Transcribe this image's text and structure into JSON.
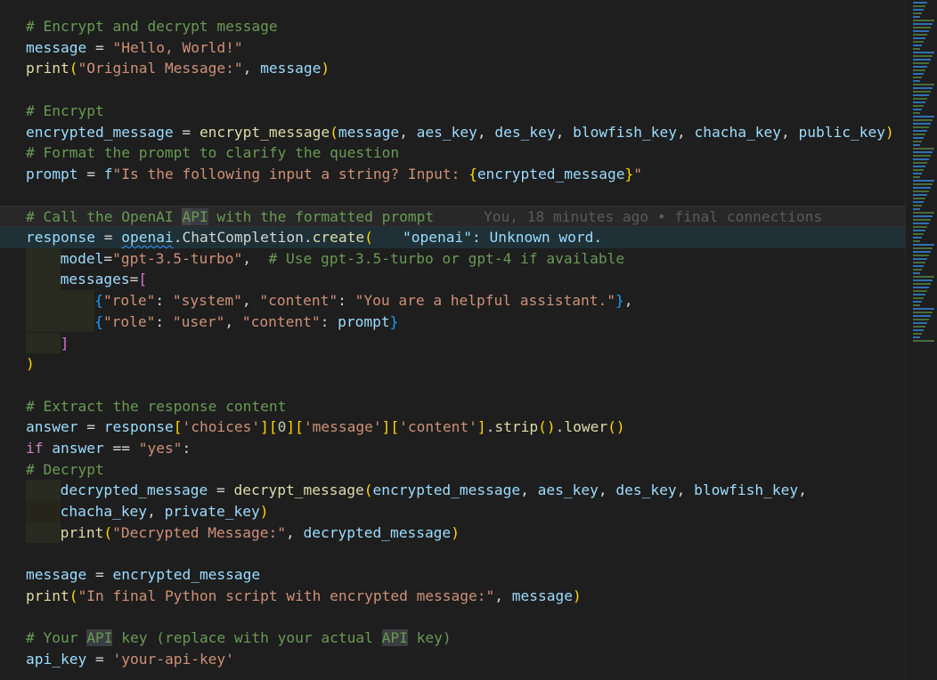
{
  "editor": {
    "lines": [
      [
        {
          "t": "# Encrypt and decrypt message",
          "c": "comment"
        }
      ],
      [
        {
          "t": "message",
          "c": "var"
        },
        {
          "t": " = ",
          "c": "op"
        },
        {
          "t": "\"Hello, World!\"",
          "c": "str"
        }
      ],
      [
        {
          "t": "print",
          "c": "fn"
        },
        {
          "t": "(",
          "c": "brace1"
        },
        {
          "t": "\"Original Message:\"",
          "c": "str"
        },
        {
          "t": ", ",
          "c": "op"
        },
        {
          "t": "message",
          "c": "var"
        },
        {
          "t": ")",
          "c": "brace1"
        }
      ],
      [],
      [
        {
          "t": "# Encrypt",
          "c": "comment"
        }
      ],
      [
        {
          "t": "encrypted_message",
          "c": "var"
        },
        {
          "t": " = ",
          "c": "op"
        },
        {
          "t": "encrypt_message",
          "c": "fn"
        },
        {
          "t": "(",
          "c": "brace1"
        },
        {
          "t": "message",
          "c": "var"
        },
        {
          "t": ", ",
          "c": "op"
        },
        {
          "t": "aes_key",
          "c": "var"
        },
        {
          "t": ", ",
          "c": "op"
        },
        {
          "t": "des_key",
          "c": "var"
        },
        {
          "t": ", ",
          "c": "op"
        },
        {
          "t": "blowfish_key",
          "c": "var"
        },
        {
          "t": ", ",
          "c": "op"
        },
        {
          "t": "chacha_key",
          "c": "var"
        },
        {
          "t": ", ",
          "c": "op"
        },
        {
          "t": "public_key",
          "c": "var"
        },
        {
          "t": ")",
          "c": "brace1"
        }
      ],
      [
        {
          "t": "# Format the prompt to clarify the question",
          "c": "comment"
        }
      ],
      [
        {
          "t": "prompt",
          "c": "var"
        },
        {
          "t": " = ",
          "c": "op"
        },
        {
          "t": "f",
          "c": "kw2"
        },
        {
          "t": "\"Is the following input a string? Input: ",
          "c": "str"
        },
        {
          "t": "{",
          "c": "brace1"
        },
        {
          "t": "encrypted_message",
          "c": "var"
        },
        {
          "t": "}",
          "c": "brace1"
        },
        {
          "t": "\"",
          "c": "str"
        }
      ],
      [],
      [
        {
          "t": "# Call the OpenAI ",
          "c": "comment"
        },
        {
          "t": "A",
          "c": "comment-cursor"
        },
        {
          "t": "PI",
          "c": "comment-hl"
        },
        {
          "t": " with the formatted prompt",
          "c": "comment"
        }
      ],
      [
        {
          "t": "response",
          "c": "var"
        },
        {
          "t": " = ",
          "c": "op"
        },
        {
          "t": "openai",
          "c": "var-squiggle"
        },
        {
          "t": ".",
          "c": "op"
        },
        {
          "t": "ChatCompletion",
          "c": "op"
        },
        {
          "t": ".",
          "c": "op"
        },
        {
          "t": "create",
          "c": "fn"
        },
        {
          "t": "(",
          "c": "brace1"
        }
      ],
      [
        {
          "indent": 1
        },
        {
          "t": "model",
          "c": "var"
        },
        {
          "t": "=",
          "c": "op"
        },
        {
          "t": "\"gpt-3.5-turbo\"",
          "c": "str"
        },
        {
          "t": ",  ",
          "c": "op"
        },
        {
          "t": "# Use gpt-3.5-turbo or gpt-4 if available",
          "c": "comment"
        }
      ],
      [
        {
          "indent": 1
        },
        {
          "t": "messages",
          "c": "var"
        },
        {
          "t": "=",
          "c": "op"
        },
        {
          "t": "[",
          "c": "brace2"
        }
      ],
      [
        {
          "indent": 2
        },
        {
          "t": "{",
          "c": "brace3"
        },
        {
          "t": "\"role\"",
          "c": "str"
        },
        {
          "t": ": ",
          "c": "op"
        },
        {
          "t": "\"system\"",
          "c": "str"
        },
        {
          "t": ", ",
          "c": "op"
        },
        {
          "t": "\"content\"",
          "c": "str"
        },
        {
          "t": ": ",
          "c": "op"
        },
        {
          "t": "\"You are a helpful assistant.\"",
          "c": "str"
        },
        {
          "t": "}",
          "c": "brace3"
        },
        {
          "t": ",",
          "c": "op"
        }
      ],
      [
        {
          "indent": 2
        },
        {
          "t": "{",
          "c": "brace3"
        },
        {
          "t": "\"role\"",
          "c": "str"
        },
        {
          "t": ": ",
          "c": "op"
        },
        {
          "t": "\"user\"",
          "c": "str"
        },
        {
          "t": ", ",
          "c": "op"
        },
        {
          "t": "\"content\"",
          "c": "str"
        },
        {
          "t": ": ",
          "c": "op"
        },
        {
          "t": "prompt",
          "c": "var"
        },
        {
          "t": "}",
          "c": "brace3"
        }
      ],
      [
        {
          "indent": 1
        },
        {
          "t": "]",
          "c": "brace2"
        }
      ],
      [
        {
          "t": ")",
          "c": "brace1"
        }
      ],
      [],
      [
        {
          "t": "# Extract the response content",
          "c": "comment"
        }
      ],
      [
        {
          "t": "answer",
          "c": "var"
        },
        {
          "t": " = ",
          "c": "op"
        },
        {
          "t": "response",
          "c": "var"
        },
        {
          "t": "[",
          "c": "brace1"
        },
        {
          "t": "'choices'",
          "c": "str"
        },
        {
          "t": "]",
          "c": "brace1"
        },
        {
          "t": "[",
          "c": "brace1"
        },
        {
          "t": "0",
          "c": "num"
        },
        {
          "t": "]",
          "c": "brace1"
        },
        {
          "t": "[",
          "c": "brace1"
        },
        {
          "t": "'message'",
          "c": "str"
        },
        {
          "t": "]",
          "c": "brace1"
        },
        {
          "t": "[",
          "c": "brace1"
        },
        {
          "t": "'content'",
          "c": "str"
        },
        {
          "t": "]",
          "c": "brace1"
        },
        {
          "t": ".",
          "c": "op"
        },
        {
          "t": "strip",
          "c": "fn"
        },
        {
          "t": "()",
          "c": "brace1"
        },
        {
          "t": ".",
          "c": "op"
        },
        {
          "t": "lower",
          "c": "fn"
        },
        {
          "t": "()",
          "c": "brace1"
        }
      ],
      [
        {
          "t": "if",
          "c": "kw"
        },
        {
          "t": " ",
          "c": "op"
        },
        {
          "t": "answer",
          "c": "var"
        },
        {
          "t": " == ",
          "c": "op"
        },
        {
          "t": "\"yes\"",
          "c": "str"
        },
        {
          "t": ":",
          "c": "op"
        }
      ],
      [
        {
          "t": "# Decrypt",
          "c": "comment"
        }
      ],
      [
        {
          "indent": 1
        },
        {
          "t": "decrypted_message",
          "c": "var"
        },
        {
          "t": " = ",
          "c": "op"
        },
        {
          "t": "decrypt_message",
          "c": "fn"
        },
        {
          "t": "(",
          "c": "brace1"
        },
        {
          "t": "encrypted_message",
          "c": "var"
        },
        {
          "t": ", ",
          "c": "op"
        },
        {
          "t": "aes_key",
          "c": "var"
        },
        {
          "t": ", ",
          "c": "op"
        },
        {
          "t": "des_key",
          "c": "var"
        },
        {
          "t": ", ",
          "c": "op"
        },
        {
          "t": "blowfish_key",
          "c": "var"
        },
        {
          "t": ",",
          "c": "op"
        }
      ],
      [
        {
          "indent": 1,
          "dim": true
        },
        {
          "t": "chacha_key",
          "c": "var"
        },
        {
          "t": ", ",
          "c": "op"
        },
        {
          "t": "private_key",
          "c": "var"
        },
        {
          "t": ")",
          "c": "brace1"
        }
      ],
      [
        {
          "indent": 1
        },
        {
          "t": "print",
          "c": "fn"
        },
        {
          "t": "(",
          "c": "brace1"
        },
        {
          "t": "\"Decrypted Message:\"",
          "c": "str"
        },
        {
          "t": ", ",
          "c": "op"
        },
        {
          "t": "decrypted_message",
          "c": "var"
        },
        {
          "t": ")",
          "c": "brace1"
        }
      ],
      [],
      [
        {
          "t": "message",
          "c": "var"
        },
        {
          "t": " = ",
          "c": "op"
        },
        {
          "t": "encrypted_message",
          "c": "var"
        }
      ],
      [
        {
          "t": "print",
          "c": "fn"
        },
        {
          "t": "(",
          "c": "brace1"
        },
        {
          "t": "\"In final Python script with encrypted message:\"",
          "c": "str"
        },
        {
          "t": ", ",
          "c": "op"
        },
        {
          "t": "message",
          "c": "var"
        },
        {
          "t": ")",
          "c": "brace1"
        }
      ],
      [],
      [
        {
          "t": "# Your ",
          "c": "comment"
        },
        {
          "t": "API",
          "c": "comment-hl"
        },
        {
          "t": " key (replace with your actual ",
          "c": "comment"
        },
        {
          "t": "API",
          "c": "comment-hl"
        },
        {
          "t": " key)",
          "c": "comment"
        }
      ],
      [
        {
          "t": "api_key",
          "c": "var"
        },
        {
          "t": " = ",
          "c": "op"
        },
        {
          "t": "'your-api-key'",
          "c": "str"
        }
      ]
    ],
    "blame_text": "You, 18 minutes ago • final connections",
    "diagnostic_text": "\"openai\": Unknown word.",
    "current_line_index": 9,
    "diagnostic_line_index": 10
  },
  "theme": {
    "background": "#1e1e1e",
    "comment": "#6a9955",
    "variable": "#9cdcfe",
    "function": "#dcdcaa",
    "string": "#ce9178"
  }
}
